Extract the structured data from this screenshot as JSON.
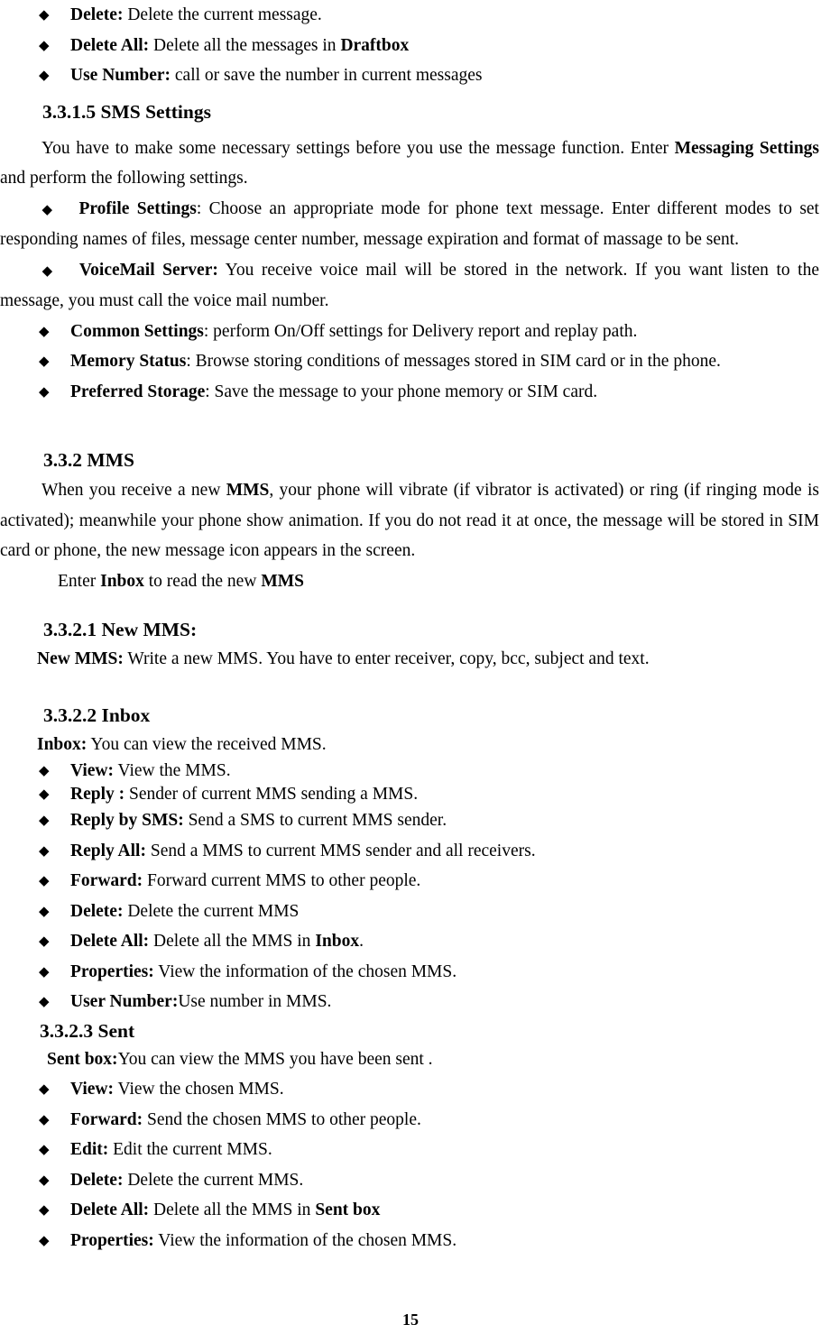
{
  "document": {
    "page_number": "15",
    "bullet_glyph": "◆"
  },
  "sms_draftbox_options": [
    {
      "term": "Delete:",
      "desc": " Delete the current message."
    },
    {
      "term": "Delete All:",
      "desc": " Delete all the messages in ",
      "desc_bold_tail": "Draftbox"
    },
    {
      "term": "Use Number:",
      "desc": " call or save the number in current messages"
    }
  ],
  "sms_settings": {
    "heading": "3.3.1.5 SMS Settings",
    "intro_part1": "You have to make some necessary settings before you use the message function. Enter ",
    "intro_bold1": "Messaging Settings",
    "intro_part2": " and perform the following settings.",
    "profile_settings": {
      "term": "Profile Settings",
      "desc": ": Choose an appropriate mode for phone text message. Enter different modes to set responding names of files, message center number, message expiration and format of massage to be sent."
    },
    "voicemail_server": {
      "term": "VoiceMail Server:",
      "desc": " You receive voice mail will be stored in the network. If you want listen to the message, you must call the voice mail number."
    },
    "options": [
      {
        "term": "Common Settings",
        "desc": ": perform On/Off settings for Delivery report and replay path."
      },
      {
        "term": "Memory Status",
        "desc": ": Browse storing conditions of messages stored in SIM card or in the phone."
      },
      {
        "term": "Preferred Storage",
        "desc": ": Save the message to your phone memory or SIM card."
      }
    ]
  },
  "mms": {
    "heading": "3.3.2 MMS",
    "intro_part1": "When you receive a new ",
    "intro_bold1": "MMS",
    "intro_part2": ", your phone will vibrate (if vibrator is activated) or ring (if ringing mode is activated); meanwhile your phone show animation. If you do not read it at once, the message will be stored in SIM card or phone, the new message icon appears in the screen.",
    "enter_line_part1": "Enter ",
    "enter_line_bold1": "Inbox",
    "enter_line_part2": " to read the new ",
    "enter_line_bold2": "MMS"
  },
  "new_mms": {
    "heading": "3.3.2.1 New MMS:",
    "term": "New MMS:",
    "desc": " Write a new MMS. You have to enter receiver, copy, bcc, subject and text."
  },
  "inbox": {
    "heading": "3.3.2.2 Inbox",
    "term": "Inbox:",
    "desc": " You can view the received MMS.",
    "options": [
      {
        "term": "View:",
        "desc": " View the MMS."
      },
      {
        "term": "Reply :",
        "desc": " Sender of current MMS sending a MMS."
      },
      {
        "term": "Reply by SMS:",
        "desc": " Send a SMS to current MMS sender."
      },
      {
        "term": "Reply All:",
        "desc": " Send a MMS to current MMS sender and all receivers."
      },
      {
        "term": "Forward:",
        "desc": " Forward current MMS to other people."
      },
      {
        "term": "Delete:",
        "desc": " Delete the current MMS"
      },
      {
        "term": "Delete All:",
        "desc": " Delete all the MMS in ",
        "desc_bold_tail": "Inbox",
        "desc_tail": "."
      },
      {
        "term": "Properties:",
        "desc": " View the information of the chosen MMS."
      },
      {
        "term": "User Number:",
        "desc": "Use number in MMS."
      }
    ]
  },
  "sent": {
    "heading": "3.3.2.3 Sent",
    "term": "Sent box:",
    "desc": "You can view the MMS you have been sent .",
    "options": [
      {
        "term": "View:",
        "desc": " View the chosen MMS."
      },
      {
        "term": "Forward:",
        "desc": " Send the chosen MMS to other people."
      },
      {
        "term": "Edit:",
        "desc": " Edit the current MMS."
      },
      {
        "term": "Delete:",
        "desc": " Delete the current MMS."
      },
      {
        "term": "Delete All:",
        "desc": " Delete all the MMS in ",
        "desc_bold_tail": "Sent box"
      },
      {
        "term": "Properties:",
        "desc": " View the information of the chosen MMS."
      }
    ]
  }
}
